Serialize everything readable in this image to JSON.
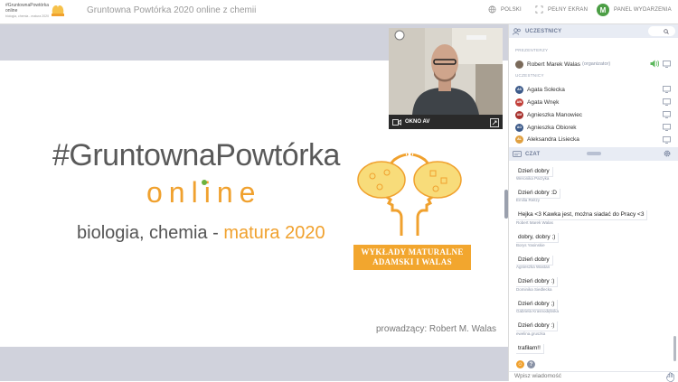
{
  "topbar": {
    "logo_text": "#GruntownaPowtórka online",
    "logo_sub": "biologia, chemia - matura 2020",
    "title": "Gruntowna Powtórka 2020 online z chemii",
    "language_label": "POLSKI",
    "fullscreen_label": "PEŁNY EKRAN",
    "user_initial": "M",
    "events_panel_label": "PANEL WYDARZENIA"
  },
  "slide": {
    "hashtag": "#GruntownaPowtórka",
    "online": "online",
    "subtitle_main": "biologia, chemia - ",
    "subtitle_accent": "matura 2020",
    "banner_line1": "WYKŁADY MATURALNE",
    "banner_line2": "ADAMSKI I WALAS",
    "footer": "prowadzący: Robert M. Walas"
  },
  "video": {
    "label": "OKNO AV"
  },
  "participants": {
    "header": "UCZESTNICY",
    "presenters_label": "PREZENTERZY",
    "participants_label": "UCZESTNICY",
    "presenter": {
      "name": "Robert Marek Walas",
      "role": "(organizator)"
    },
    "people": [
      {
        "initials": "AS",
        "name": "Agata Solecka",
        "color": "#3d5b8a"
      },
      {
        "initials": "AW",
        "name": "Agata Wnęk",
        "color": "#c2403a"
      },
      {
        "initials": "AM",
        "name": "Agnieszka Manowiec",
        "color": "#a8322e"
      },
      {
        "initials": "AO",
        "name": "Agnieszka Obiorek",
        "color": "#3d5b8a"
      },
      {
        "initials": "AL",
        "name": "Aleksandra Lisiecka",
        "color": "#e0a040"
      }
    ]
  },
  "chat": {
    "header": "CZAT",
    "messages": [
      {
        "author": "",
        "text": "Dzień dobry"
      },
      {
        "author": "Weronika Parzyka",
        "text": "Dzień dobry :D"
      },
      {
        "author": "Emilia Reitzy",
        "text": "Hejka <3 Kawka jest, można siadać do Pracy <3"
      },
      {
        "author": "Robert Marek Walas",
        "text": "dobry, dobry ;)"
      },
      {
        "author": "Borys Yasinskie",
        "text": "Dzień dobry"
      },
      {
        "author": "Agnieszka Wastan",
        "text": "Dzień dobry :)"
      },
      {
        "author": "Dominika Siedlecka",
        "text": "Dzień dobry ;)"
      },
      {
        "author": "Gabriela Krasnodębska",
        "text": "Dzień dobry :)"
      },
      {
        "author": "ewelina.gruszka",
        "text": "trafiłam!!"
      }
    ],
    "input_placeholder": "Wpisz wiadomość"
  },
  "colors": {
    "accent_orange": "#f0a12e",
    "accent_green": "#6cb33f",
    "sidebar_header_bg": "#e8ecf4"
  }
}
